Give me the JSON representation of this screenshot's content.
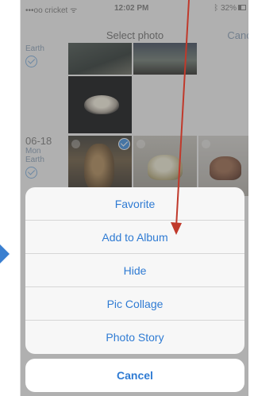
{
  "status_bar": {
    "carrier": "•••oo cricket ᯤ",
    "time": "12:02 PM",
    "battery": "ᛒ 32%"
  },
  "nav": {
    "title": "Select photo",
    "cancel": "Cance"
  },
  "groups": [
    {
      "location": "Earth"
    },
    {
      "date": "06-18",
      "weekday": "Mon",
      "location": "Earth"
    }
  ],
  "action_sheet": {
    "items": [
      {
        "label": "Favorite"
      },
      {
        "label": "Add to Album"
      },
      {
        "label": "Hide"
      },
      {
        "label": "Pic Collage"
      },
      {
        "label": "Photo Story"
      }
    ],
    "cancel_label": "Cancel"
  },
  "colors": {
    "accent": "#2f7bd3",
    "annotation_arrow": "#c0392b",
    "left_pointer": "#3a7fd0"
  }
}
